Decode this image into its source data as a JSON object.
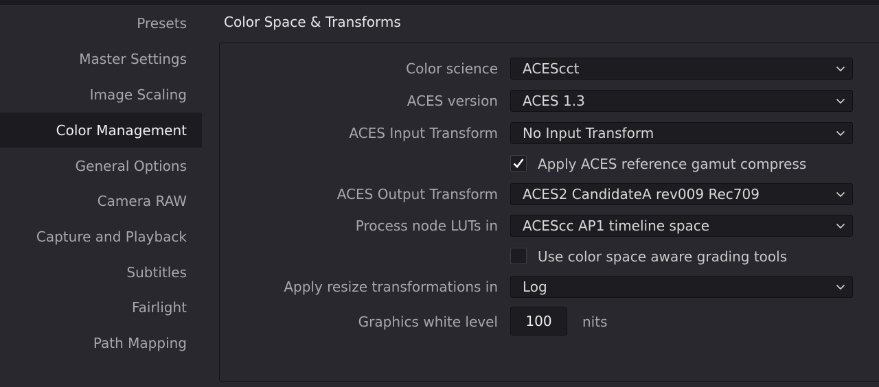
{
  "sidebar": {
    "items": [
      {
        "label": "Presets",
        "active": false
      },
      {
        "label": "Master Settings",
        "active": false
      },
      {
        "label": "Image Scaling",
        "active": false
      },
      {
        "label": "Color Management",
        "active": true
      },
      {
        "label": "General Options",
        "active": false
      },
      {
        "label": "Camera RAW",
        "active": false
      },
      {
        "label": "Capture and Playback",
        "active": false
      },
      {
        "label": "Subtitles",
        "active": false
      },
      {
        "label": "Fairlight",
        "active": false
      },
      {
        "label": "Path Mapping",
        "active": false
      }
    ]
  },
  "section": {
    "title": "Color Space & Transforms"
  },
  "settings": {
    "color_science": {
      "label": "Color science",
      "value": "ACEScct"
    },
    "aces_version": {
      "label": "ACES version",
      "value": "ACES 1.3"
    },
    "aces_input_transform": {
      "label": "ACES Input Transform",
      "value": "No Input Transform"
    },
    "gamut_compress": {
      "label": "Apply ACES reference gamut compress",
      "checked": true
    },
    "aces_output_transform": {
      "label": "ACES Output Transform",
      "value": "ACES2 CandidateA rev009 Rec709"
    },
    "process_node_luts": {
      "label": "Process node LUTs in",
      "value": "ACEScc AP1 timeline space"
    },
    "color_space_aware": {
      "label": "Use color space aware grading tools",
      "checked": false
    },
    "resize_transformations": {
      "label": "Apply resize transformations in",
      "value": "Log"
    },
    "graphics_white_level": {
      "label": "Graphics white level",
      "value": "100",
      "unit": "nits"
    }
  },
  "colors": {
    "background": "#28282e",
    "active_nav_bg": "#1c1c20",
    "control_bg": "#1d1d21",
    "text_primary": "#f0f0f0",
    "text_secondary": "#a8a8ac"
  },
  "icons": {
    "dropdown": "chevron-down-icon",
    "checkbox_checked": "checkmark-icon"
  }
}
